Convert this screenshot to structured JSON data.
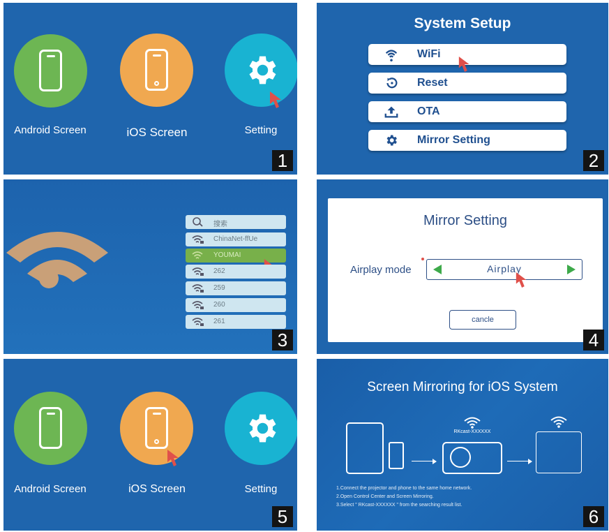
{
  "panels": {
    "p1": {
      "number": "1",
      "android_label": "Android Screen",
      "ios_label": "iOS Screen",
      "setting_label": "Setting"
    },
    "p2": {
      "number": "2",
      "title": "System Setup",
      "menu": [
        {
          "label": "WiFi",
          "icon": "wifi-icon"
        },
        {
          "label": "Reset",
          "icon": "reset-icon"
        },
        {
          "label": "OTA",
          "icon": "upload-icon"
        },
        {
          "label": "Mirror Setting",
          "icon": "gear-icon"
        }
      ]
    },
    "p3": {
      "number": "3",
      "search_placeholder": "搜索",
      "networks": [
        "ChinaNet-ffUe",
        "YOUMAI",
        "262",
        "259",
        "260",
        "261"
      ],
      "selected": "YOUMAI"
    },
    "p4": {
      "number": "4",
      "title": "Mirror Setting",
      "mode_label": "Airplay mode",
      "mode_value": "Airplay",
      "cancel_label": "cancle"
    },
    "p5": {
      "number": "5",
      "android_label": "Android Screen",
      "ios_label": "iOS Screen",
      "setting_label": "Setting"
    },
    "p6": {
      "number": "6",
      "title": "Screen Mirroring for iOS System",
      "device_ssid": "RKcast-XXXXXX",
      "instructions": [
        "1.Connect the projector and phone to the same home network.",
        "2.Open Control Center and Screen Mirroring.",
        "3.Select \" RKcast-XXXXXX \" from the searching result list."
      ]
    }
  },
  "colors": {
    "background_blue": "#1f65ad",
    "android_green": "#6db653",
    "ios_orange": "#f0a850",
    "setting_cyan": "#19b3d2",
    "wifi_tan": "#c9a078",
    "pointer_red": "#e0504a",
    "selected_green": "#78b04a"
  }
}
